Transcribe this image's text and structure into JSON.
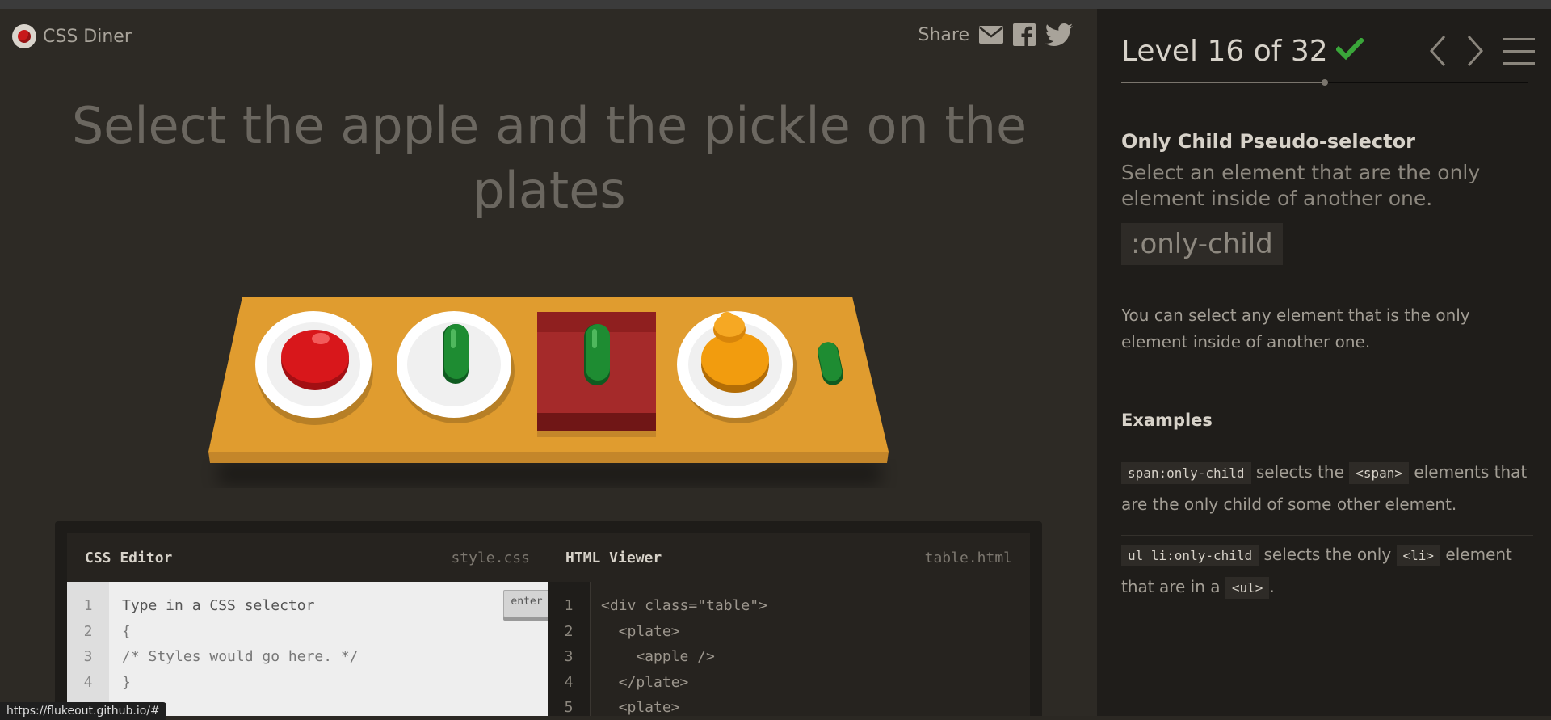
{
  "header": {
    "app_name": "CSS Diner",
    "share_label": "Share",
    "share_icons": [
      "mail-icon",
      "facebook-icon",
      "twitter-icon"
    ]
  },
  "instruction": "Select the apple and the pickle on the plates",
  "table_items": [
    {
      "container": "plate",
      "item": "apple"
    },
    {
      "container": "plate",
      "item": "pickle"
    },
    {
      "container": "bento",
      "item": "pickle"
    },
    {
      "container": "plate",
      "item": "orange"
    },
    {
      "container": "none",
      "item": "pickle-small"
    }
  ],
  "css_editor": {
    "title": "CSS Editor",
    "file": "style.css",
    "enter_label": "enter",
    "line_numbers": [
      "1",
      "2",
      "3",
      "4"
    ],
    "lines": [
      "Type in a CSS selector",
      "{",
      "/* Styles would go here. */",
      "}"
    ]
  },
  "html_viewer": {
    "title": "HTML Viewer",
    "file": "table.html",
    "line_numbers": [
      "1",
      "2",
      "3",
      "4",
      "5"
    ],
    "lines": [
      "<div class=\"table\">",
      "  <plate>",
      "    <apple />",
      "  </plate>",
      "  <plate>"
    ]
  },
  "status_bar": "https://flukeout.github.io/#",
  "sidebar": {
    "level_text": "Level 16 of 32",
    "level_current": 16,
    "level_total": 32,
    "completed": true,
    "selector_name": "Only Child Pseudo-selector",
    "selector_title": "Select an element that are the only element inside of another one.",
    "syntax": ":only-child",
    "hint": "You can select any element that is the only element inside of another one.",
    "examples_title": "Examples",
    "examples": [
      {
        "code1": "span:only-child",
        "text1": " selects the ",
        "code2": "<span>",
        "text2": " elements that are the only child of some other element."
      },
      {
        "code1": "ul li:only-child",
        "text1": " selects the only ",
        "code2": "<li>",
        "text2": " element that are in a ",
        "code3": "<ul>",
        "text3": "."
      }
    ]
  },
  "colors": {
    "accent_green": "#3aa63a",
    "table": "#e09c2f",
    "apple": "#d8171b",
    "pickle": "#1e8c32",
    "orange": "#f29c0e",
    "bento": "#8f1f1f"
  }
}
